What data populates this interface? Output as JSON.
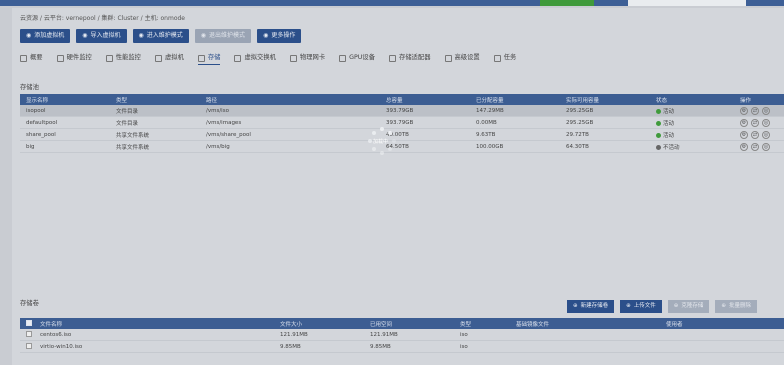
{
  "breadcrumb": [
    "云资源 / 云平台: vernepool / 集群: Cluster / 主机: onmode"
  ],
  "toolbar": [
    {
      "label": "添加虚拟机",
      "icon": "plus-circle-icon",
      "disabled": false
    },
    {
      "label": "导入虚拟机",
      "icon": "import-icon",
      "disabled": false
    },
    {
      "label": "进入维护模式",
      "icon": "wrench-icon",
      "disabled": false
    },
    {
      "label": "退出维护模式",
      "icon": "exit-icon",
      "disabled": true
    },
    {
      "label": "更多操作",
      "icon": "more-icon",
      "disabled": false
    }
  ],
  "tabs": [
    {
      "label": "概要",
      "icon": "list-icon",
      "active": false
    },
    {
      "label": "硬件监控",
      "icon": "monitor-icon",
      "active": false
    },
    {
      "label": "性能监控",
      "icon": "gauge-icon",
      "active": false
    },
    {
      "label": "虚拟机",
      "icon": "vm-icon",
      "active": false
    },
    {
      "label": "存储",
      "icon": "storage-icon",
      "active": true
    },
    {
      "label": "虚拟交换机",
      "icon": "switch-icon",
      "active": false
    },
    {
      "label": "物理网卡",
      "icon": "nic-icon",
      "active": false
    },
    {
      "label": "GPU设备",
      "icon": "gpu-icon",
      "active": false
    },
    {
      "label": "存储适配器",
      "icon": "adapter-icon",
      "active": false
    },
    {
      "label": "高级设置",
      "icon": "settings-icon",
      "active": false
    },
    {
      "label": "任务",
      "icon": "task-icon",
      "active": false
    }
  ],
  "pool_section": {
    "title": "存储池",
    "headers": [
      "显示名称",
      "类型",
      "路径",
      "总容量",
      "已分配容量",
      "实际可用容量",
      "状态",
      "操作"
    ],
    "rows": [
      {
        "name": "isopool",
        "type": "文件目录",
        "path": "/vms/iso",
        "total": "393.79GB",
        "allocated": "147.29MB",
        "available": "295.25GB",
        "status": "活动",
        "status_color": "#3f9a3b",
        "selected": true
      },
      {
        "name": "defaultpool",
        "type": "文件目录",
        "path": "/vms/images",
        "total": "393.79GB",
        "allocated": "0.00MB",
        "available": "295.25GB",
        "status": "活动",
        "status_color": "#3f9a3b",
        "selected": false
      },
      {
        "name": "share_pool",
        "type": "共享文件系统",
        "path": "/vms/share_pool",
        "total": "40.00TB",
        "allocated": "9.63TB",
        "available": "29.72TB",
        "status": "活动",
        "status_color": "#3f9a3b",
        "selected": false
      },
      {
        "name": "big",
        "type": "共享文件系统",
        "path": "/vms/big",
        "total": "64.50TB",
        "allocated": "100.00GB",
        "available": "64.30TB",
        "status": "不活动",
        "status_color": "#666666",
        "selected": false
      }
    ]
  },
  "loading_label": "加载中",
  "volume_section": {
    "title": "存储卷",
    "actions": [
      {
        "label": "新建存储卷",
        "icon": "plus-circle-icon",
        "disabled": false
      },
      {
        "label": "上传文件",
        "icon": "upload-icon",
        "disabled": false
      },
      {
        "label": "克隆存储",
        "icon": "clone-icon",
        "disabled": true
      },
      {
        "label": "批量删除",
        "icon": "delete-icon",
        "disabled": true
      }
    ],
    "headers": [
      "文件名称",
      "文件大小",
      "已用空间",
      "类型",
      "基础镜像文件",
      "使用者"
    ],
    "rows": [
      {
        "name": "centos6.iso",
        "size": "121.91MB",
        "used": "121.91MB",
        "type": "iso",
        "base": "",
        "user": ""
      },
      {
        "name": "virtio-win10.iso",
        "size": "9.85MB",
        "used": "9.85MB",
        "type": "iso",
        "base": "",
        "user": ""
      }
    ]
  }
}
